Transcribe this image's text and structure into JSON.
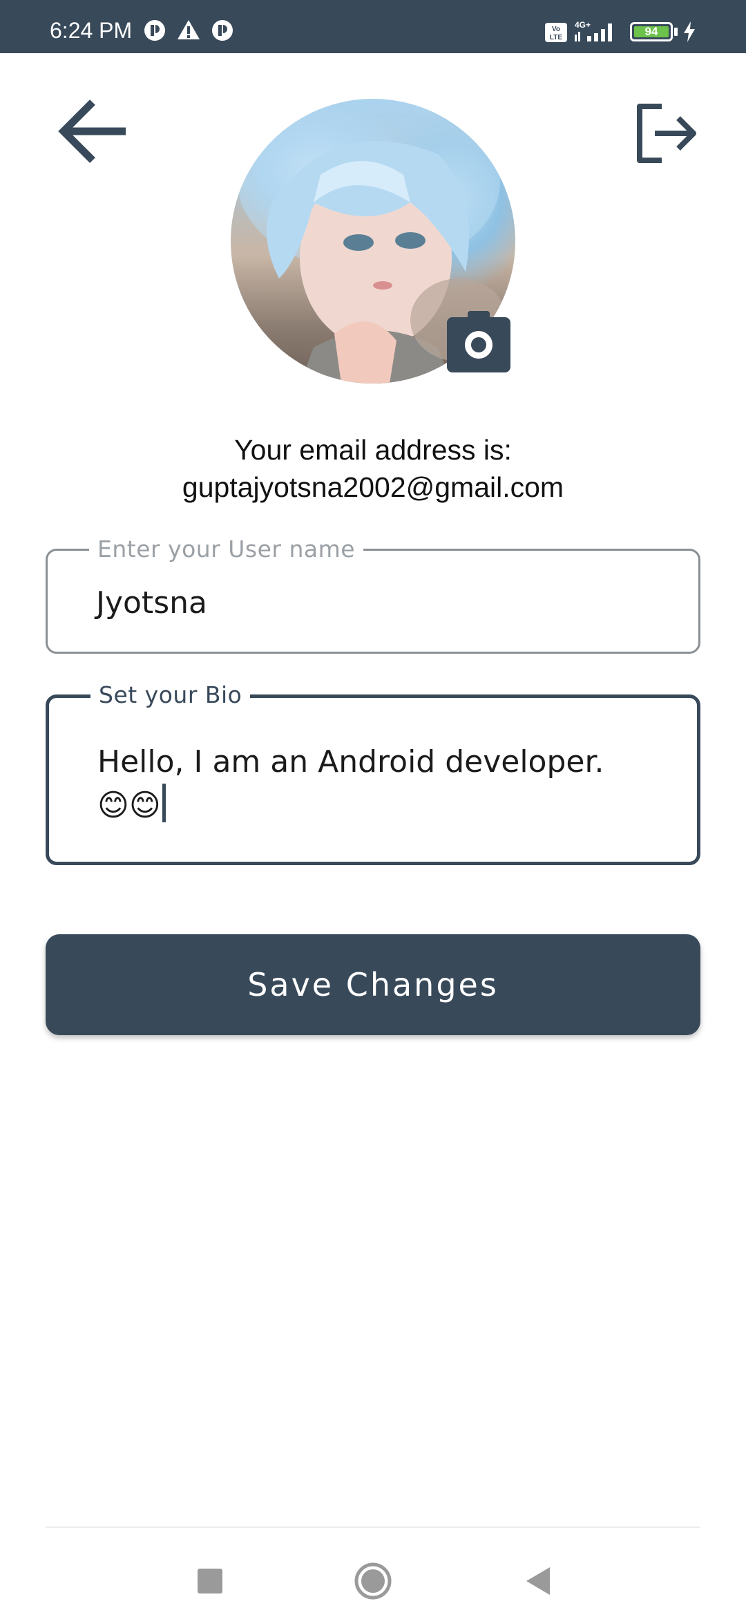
{
  "status_bar": {
    "time": "6:24 PM",
    "battery_level": "94",
    "icons": [
      "app-notification-icon",
      "warning-icon",
      "app-notification-icon",
      "volte-icon",
      "signal-4g-icon",
      "battery-icon",
      "charging-icon"
    ],
    "network_label": "4G+",
    "volte_label": "Vo LTE"
  },
  "header": {
    "back_icon": "arrow-left-icon",
    "logout_icon": "logout-icon"
  },
  "profile": {
    "avatar_icon": "profile-avatar",
    "camera_icon": "camera-icon",
    "email_label": "Your email address is:",
    "email_value": "guptajyotsna2002@gmail.com"
  },
  "form": {
    "username": {
      "label": "Enter your User name",
      "value": "Jyotsna"
    },
    "bio": {
      "label": "Set your Bio",
      "value": "Hello, I am an Android developer.\n😊😊"
    },
    "save_label": "Save Changes"
  },
  "colors": {
    "primary": "#38495a",
    "outline_inactive": "#8a8f94",
    "battery": "#6cc24a"
  },
  "nav_bar": {
    "icons": [
      "recent-apps-icon",
      "home-icon",
      "back-icon"
    ]
  }
}
